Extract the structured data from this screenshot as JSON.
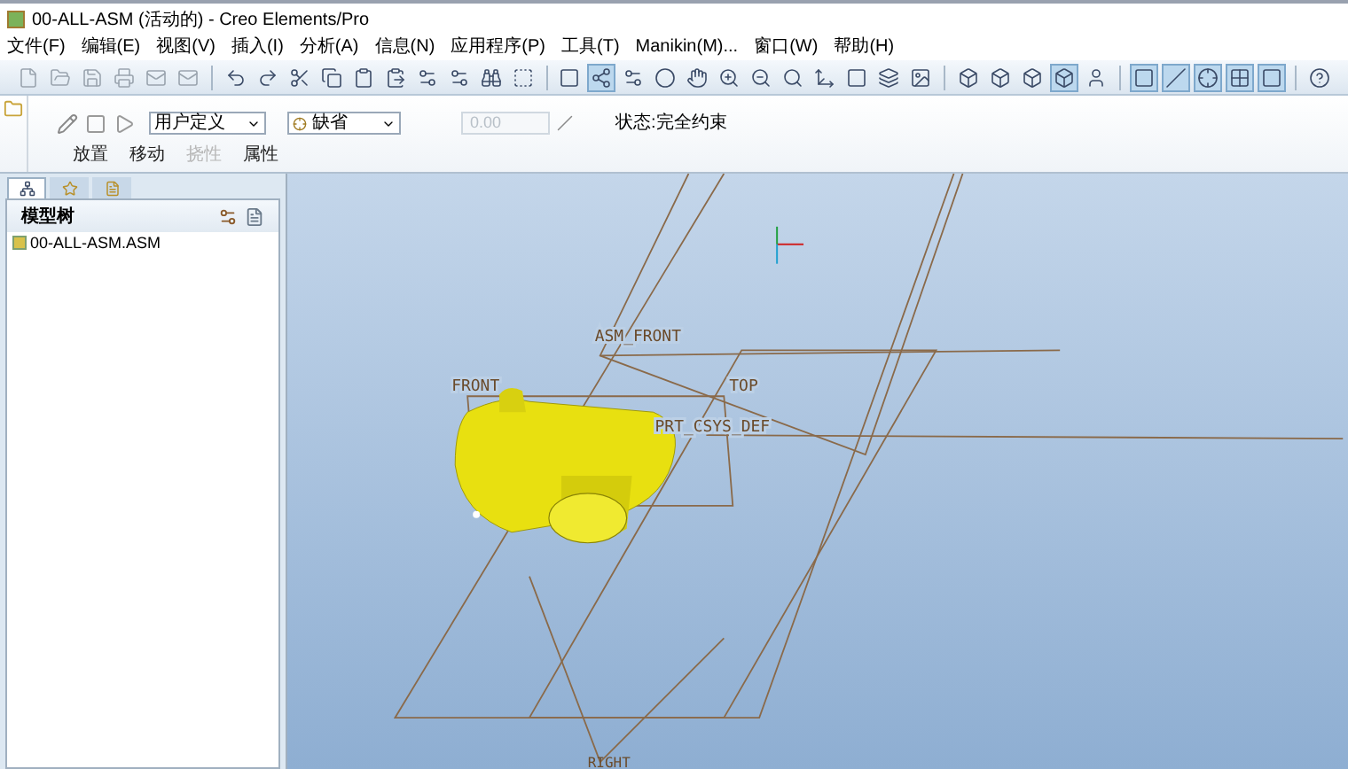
{
  "window": {
    "title": "00-ALL-ASM (活动的) - Creo Elements/Pro"
  },
  "menu": [
    "文件(F)",
    "编辑(E)",
    "视图(V)",
    "插入(I)",
    "分析(A)",
    "信息(N)",
    "应用程序(P)",
    "工具(T)",
    "Manikin(M)...",
    "窗口(W)",
    "帮助(H)"
  ],
  "toolbar": [
    {
      "pressed": false
    },
    {
      "pressed": false
    },
    {
      "pressed": false
    },
    {
      "pressed": false
    },
    {
      "pressed": false
    },
    {
      "pressed": false
    },
    {
      "pressed": false
    },
    {
      "pressed": false
    },
    {
      "pressed": false
    },
    {
      "pressed": false
    },
    {
      "pressed": false
    },
    {
      "pressed": false
    },
    {
      "pressed": false
    },
    {
      "pressed": false
    },
    {
      "pressed": false
    },
    {
      "pressed": false
    },
    {
      "pressed": false
    },
    {
      "pressed": true
    },
    {
      "pressed": false
    },
    {
      "pressed": false
    },
    {
      "pressed": false
    },
    {
      "pressed": false
    },
    {
      "pressed": false
    },
    {
      "pressed": false
    },
    {
      "pressed": false
    },
    {
      "pressed": false
    },
    {
      "pressed": false
    },
    {
      "pressed": false
    },
    {
      "pressed": false
    },
    {
      "pressed": false
    },
    {
      "pressed": false
    },
    {
      "pressed": true
    },
    {
      "pressed": false
    },
    {
      "pressed": true
    },
    {
      "pressed": true
    },
    {
      "pressed": true
    },
    {
      "pressed": true
    },
    {
      "pressed": true
    },
    {
      "pressed": false
    }
  ],
  "dashboard": {
    "constraint_type": "用户定义",
    "reference": "缺省",
    "offset": {
      "placeholder": "0.00",
      "disabled": true
    },
    "status": "状态:完全约束",
    "tabs": [
      {
        "label": "放置",
        "disabled": false
      },
      {
        "label": "移动",
        "disabled": false
      },
      {
        "label": "挠性",
        "disabled": true
      },
      {
        "label": "属性",
        "disabled": false
      }
    ]
  },
  "panel_tabs": [
    {
      "selected": true
    },
    {
      "selected": false
    },
    {
      "selected": false
    }
  ],
  "model_tree": {
    "title": "模型树",
    "items": [
      {
        "label": "00-ALL-ASM.ASM",
        "selected": false
      }
    ]
  },
  "viewport": {
    "labels": [
      "ASM_FRONT",
      "FRONT",
      "TOP",
      "PRT_CSYS_DEF",
      "RIGHT"
    ]
  }
}
